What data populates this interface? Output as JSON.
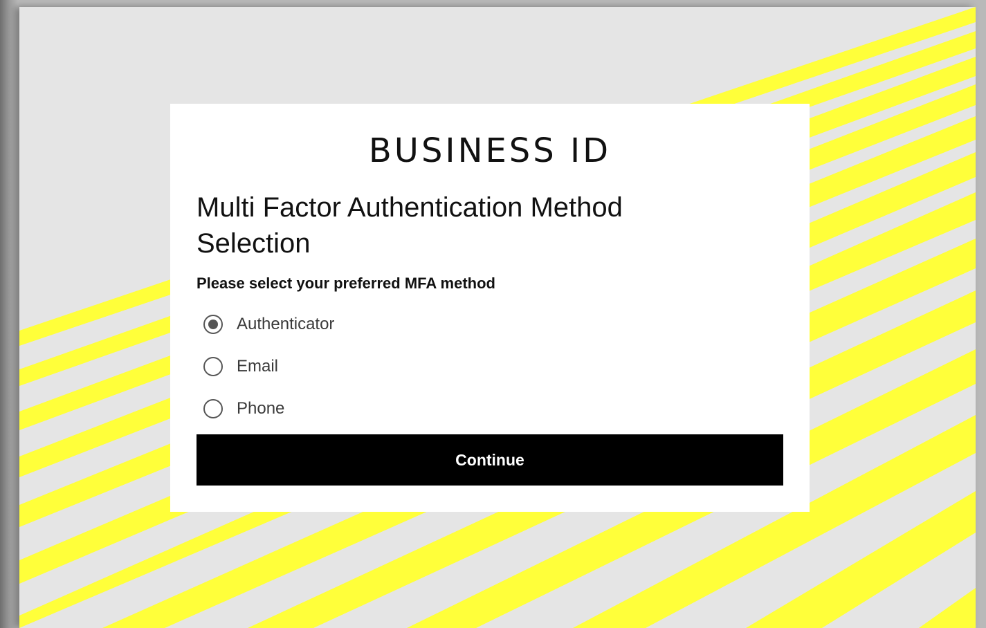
{
  "brand": {
    "logo_text": "BUSINESS ID"
  },
  "page": {
    "title": "Multi Factor Authentication Method Selection",
    "subtitle": "Please select your preferred MFA method"
  },
  "mfa_options": [
    {
      "label": "Authenticator",
      "selected": true
    },
    {
      "label": "Email",
      "selected": false
    },
    {
      "label": "Phone",
      "selected": false
    }
  ],
  "actions": {
    "continue_label": "Continue"
  },
  "colors": {
    "background": "#e5e5e5",
    "stripe": "#ffff3a",
    "card": "#ffffff",
    "button": "#000000"
  }
}
